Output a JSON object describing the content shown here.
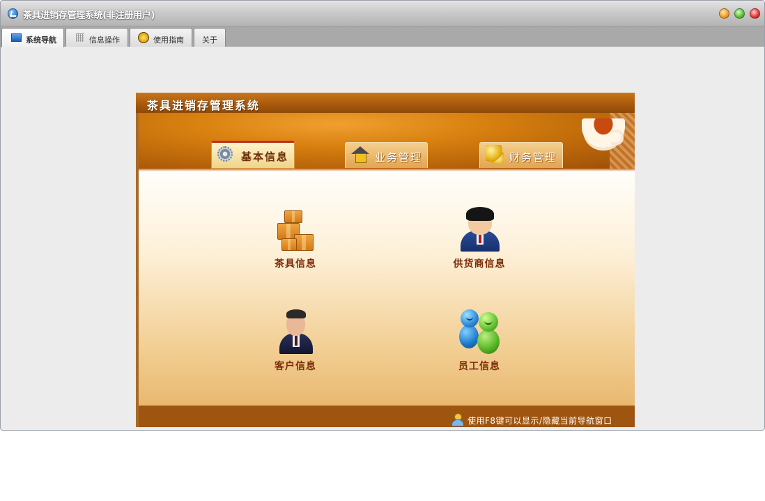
{
  "window": {
    "title": "茶具进销存管理系统(非注册用户)",
    "controls": [
      "minimize",
      "maximize",
      "close"
    ]
  },
  "tabs": [
    {
      "label": "系统导航",
      "icon": "monitor-icon",
      "active": true
    },
    {
      "label": "信息操作",
      "icon": "grid-icon",
      "active": false
    },
    {
      "label": "使用指南",
      "icon": "compass-icon",
      "active": false
    },
    {
      "label": "关于",
      "icon": "",
      "active": false
    }
  ],
  "nav_panel": {
    "title": "茶具进销存管理系统",
    "nav_tabs": [
      {
        "label": "基本信息",
        "icon": "gear-icon",
        "active": true
      },
      {
        "label": "业务管理",
        "icon": "house-icon",
        "active": false
      },
      {
        "label": "财务管理",
        "icon": "coins-icon",
        "active": false
      }
    ],
    "items": [
      {
        "label": "茶具信息",
        "icon": "boxes-icon"
      },
      {
        "label": "供货商信息",
        "icon": "supplier-icon"
      },
      {
        "label": "客户信息",
        "icon": "customer-icon"
      },
      {
        "label": "员工信息",
        "icon": "staff-icon"
      }
    ],
    "footer_tip": "使用F8键可以显示/隐藏当前导航窗口"
  },
  "colors": {
    "titlebar": "#b4b4b4",
    "panel_header": "#a95a0c",
    "footer": "#9e5510",
    "item_label": "#7a2c0a"
  }
}
